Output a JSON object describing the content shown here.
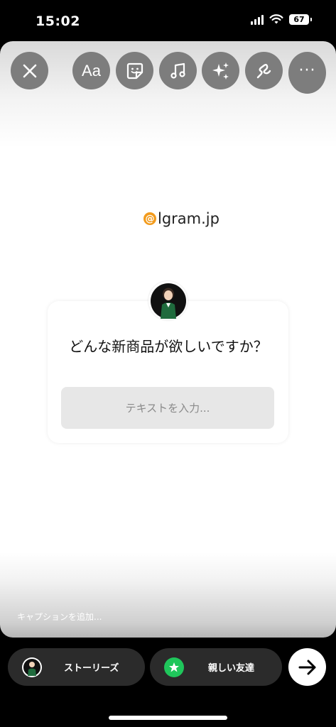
{
  "status": {
    "time": "15:02",
    "battery": "67"
  },
  "toolbar": {
    "text_tool": "Aa",
    "more": "···"
  },
  "sticker": {
    "brand": "lgram.jp",
    "question": "どんな新商品が欲しいですか？",
    "placeholder": "テキストを入力..."
  },
  "caption_placeholder": "キャプションを追加...",
  "share": {
    "stories_label": "ストーリーズ",
    "close_friends_label": "親しい友達"
  },
  "colors": {
    "accent_green": "#1fc65b",
    "brand_orange": "#f29b1d",
    "tool_gray": "#7d7d7d"
  }
}
